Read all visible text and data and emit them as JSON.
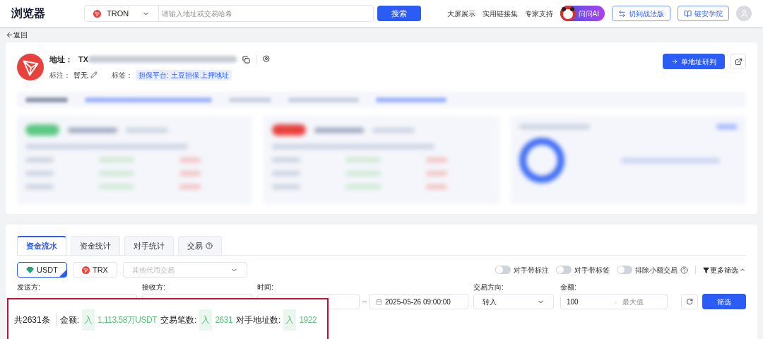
{
  "header": {
    "logo": "浏览器",
    "chain": "TRON",
    "search_placeholder": "请输入地址或交易哈希",
    "search_button": "搜索",
    "nav_links": [
      "大屏展示",
      "实用链接集",
      "专家支持"
    ],
    "ai_button": "问问AI",
    "outline_buttons": [
      {
        "kind": "switch",
        "label": "切到战法版"
      },
      {
        "kind": "book",
        "label": "链安学院"
      }
    ]
  },
  "back": "返回",
  "address": {
    "label": "地址：",
    "value": "TX",
    "remark_label": "标注：",
    "remark": "暂无",
    "tag_label": "标签：",
    "tag": "担保平台: 土豆担保 上押地址",
    "action_button": "单地址研判"
  },
  "tabs": [
    {
      "label": "资金流水",
      "selected": true,
      "help": false
    },
    {
      "label": "资金统计",
      "selected": false,
      "help": false
    },
    {
      "label": "对手统计",
      "selected": false,
      "help": false
    },
    {
      "label": "交易",
      "selected": false,
      "help": true
    }
  ],
  "tokens": [
    {
      "label": "USDT",
      "kind": "usdt",
      "selected": true
    },
    {
      "label": "TRX",
      "kind": "trx",
      "selected": false
    }
  ],
  "other_token_placeholder": "其他代币交易",
  "toggles": [
    {
      "label": "对手带标注",
      "on": false,
      "help": false
    },
    {
      "label": "对手带标签",
      "on": false,
      "help": false
    },
    {
      "label": "排除小额交易",
      "on": false,
      "help": true
    }
  ],
  "more_filters": "更多筛选",
  "filters": {
    "sender_label": "发送方:",
    "receiver_label": "接收方:",
    "time_label": "时间:",
    "end_time": "2025-05-26 09:00:00",
    "direction_label": "交易方向:",
    "direction": "转入",
    "amount_label": "金额:",
    "amount_min": "100",
    "amount_separator": "-",
    "amount_max_placeholder": "最大值",
    "submit": "筛选"
  },
  "summary": {
    "total": "共2631条",
    "items": [
      {
        "label": "金额:",
        "direction": "入",
        "value": "1,113.58万USDT"
      },
      {
        "label": "交易笔数:",
        "direction": "入",
        "value": "2631"
      },
      {
        "label": "对手地址数:",
        "direction": "入",
        "value": "1922"
      }
    ]
  }
}
